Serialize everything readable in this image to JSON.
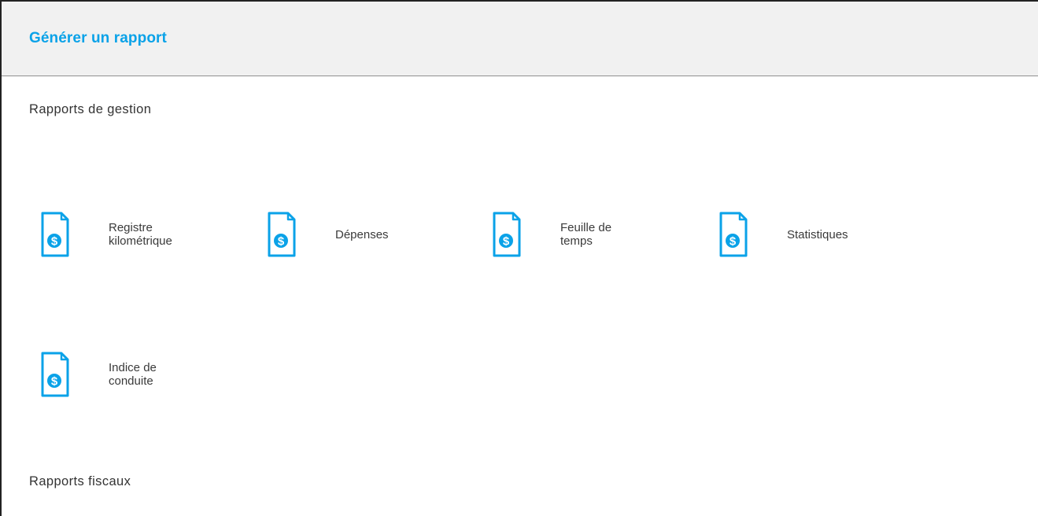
{
  "header": {
    "title": "Générer un rapport"
  },
  "sections": {
    "management": {
      "title": "Rapports de gestion",
      "items": [
        {
          "label": "Registre\nkilométrique",
          "icon": "dollar-document-icon"
        },
        {
          "label": "Dépenses",
          "icon": "dollar-document-icon"
        },
        {
          "label": "Feuille de\ntemps",
          "icon": "dollar-document-icon"
        },
        {
          "label": "Statistiques",
          "icon": "dollar-document-icon"
        },
        {
          "label": "Indice de\nconduite",
          "icon": "dollar-document-icon"
        }
      ]
    },
    "fiscal": {
      "title": "Rapports fiscaux"
    }
  },
  "colors": {
    "accent": "#0aa2e8",
    "header_background": "#f1f1f1",
    "text": "#333333"
  }
}
